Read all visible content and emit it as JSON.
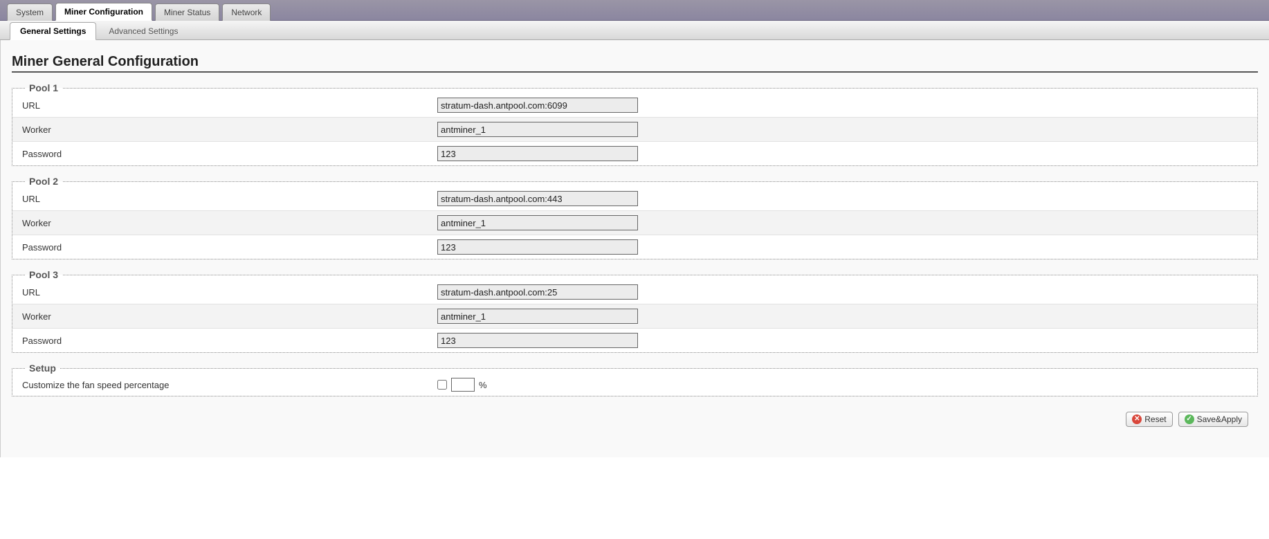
{
  "top_tabs": {
    "system": "System",
    "miner_config": "Miner Configuration",
    "miner_status": "Miner Status",
    "network": "Network"
  },
  "sub_tabs": {
    "general": "General Settings",
    "advanced": "Advanced Settings"
  },
  "page_title": "Miner General Configuration",
  "pools": [
    {
      "legend": "Pool 1",
      "url_label": "URL",
      "url_value": "stratum-dash.antpool.com:6099",
      "worker_label": "Worker",
      "worker_value": "antminer_1",
      "password_label": "Password",
      "password_value": "123"
    },
    {
      "legend": "Pool 2",
      "url_label": "URL",
      "url_value": "stratum-dash.antpool.com:443",
      "worker_label": "Worker",
      "worker_value": "antminer_1",
      "password_label": "Password",
      "password_value": "123"
    },
    {
      "legend": "Pool 3",
      "url_label": "URL",
      "url_value": "stratum-dash.antpool.com:25",
      "worker_label": "Worker",
      "worker_value": "antminer_1",
      "password_label": "Password",
      "password_value": "123"
    }
  ],
  "setup": {
    "legend": "Setup",
    "fan_label": "Customize the fan speed percentage",
    "fan_checked": false,
    "fan_value": "",
    "pct_suffix": "%"
  },
  "buttons": {
    "reset": "Reset",
    "save_apply": "Save&Apply"
  },
  "icons": {
    "reset_glyph": "✕",
    "save_glyph": "✓"
  }
}
